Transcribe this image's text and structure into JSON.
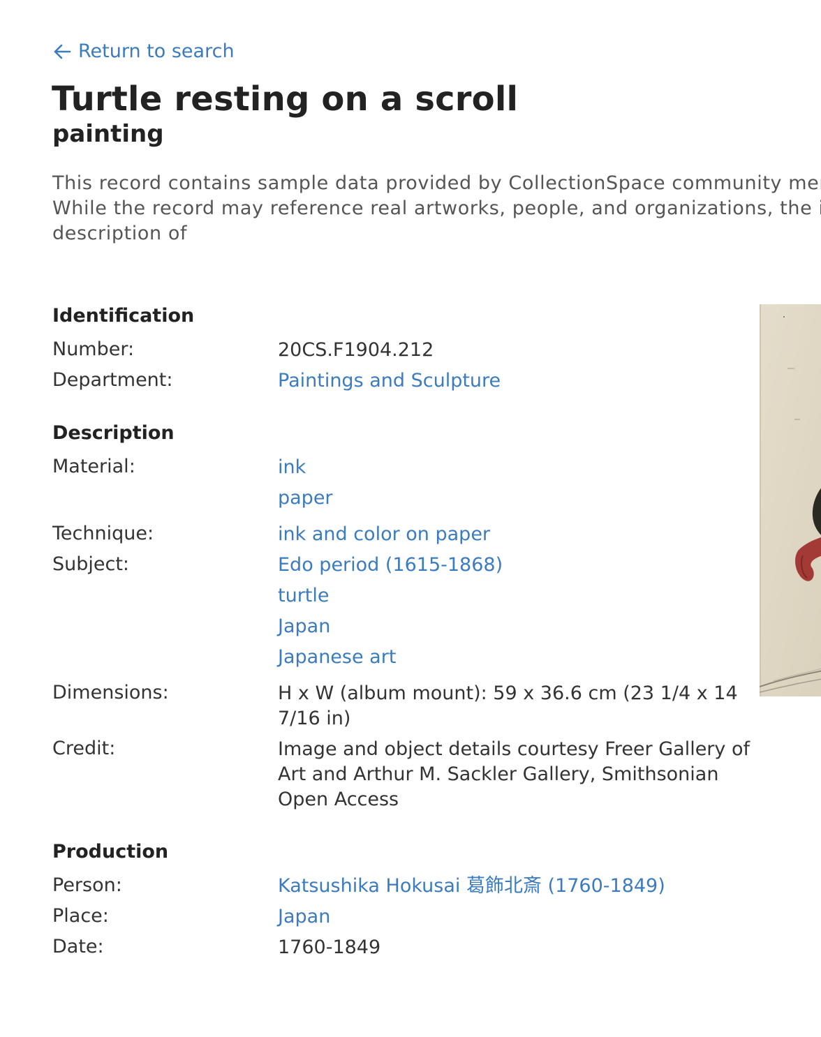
{
  "nav": {
    "back_label": "Return to search"
  },
  "record": {
    "title": "Turtle resting on a scroll",
    "object_type": "painting",
    "notice_lines": [
      "This record contains sample data provided by CollectionSpace community mer",
      "While the record may reference real artworks, people, and organizations, the in",
      "description of"
    ]
  },
  "identification": {
    "heading": "Identification",
    "number_label": "Number:",
    "number_value": "20CS.F1904.212",
    "department_label": "Department:",
    "department_value": "Paintings and Sculpture"
  },
  "description": {
    "heading": "Description",
    "material_label": "Material:",
    "materials": [
      "ink",
      "paper"
    ],
    "technique_label": "Technique:",
    "technique_value": "ink and color on paper",
    "subject_label": "Subject:",
    "subjects": [
      "Edo period (1615-1868)",
      "turtle",
      "Japan",
      "Japanese art"
    ],
    "dimensions_label": "Dimensions:",
    "dimensions_lines": [
      "H x W (album mount): 59 x 36.6 cm (23 1/4 x 14",
      "7/16 in)"
    ],
    "credit_label": "Credit:",
    "credit_lines": [
      "Image and object details courtesy Freer Gallery of",
      "Art and Arthur M. Sackler Gallery, Smithsonian",
      "Open Access"
    ]
  },
  "production": {
    "heading": "Production",
    "person_label": "Person:",
    "person_value": "Katsushika Hokusai 葛飾北斎 (1760-1849)",
    "place_label": "Place:",
    "place_value": "Japan",
    "date_label": "Date:",
    "date_value": "1760-1849"
  },
  "colors": {
    "link": "#3b7bbf",
    "heading": "#222222",
    "text": "#333333",
    "muted": "#555555"
  }
}
